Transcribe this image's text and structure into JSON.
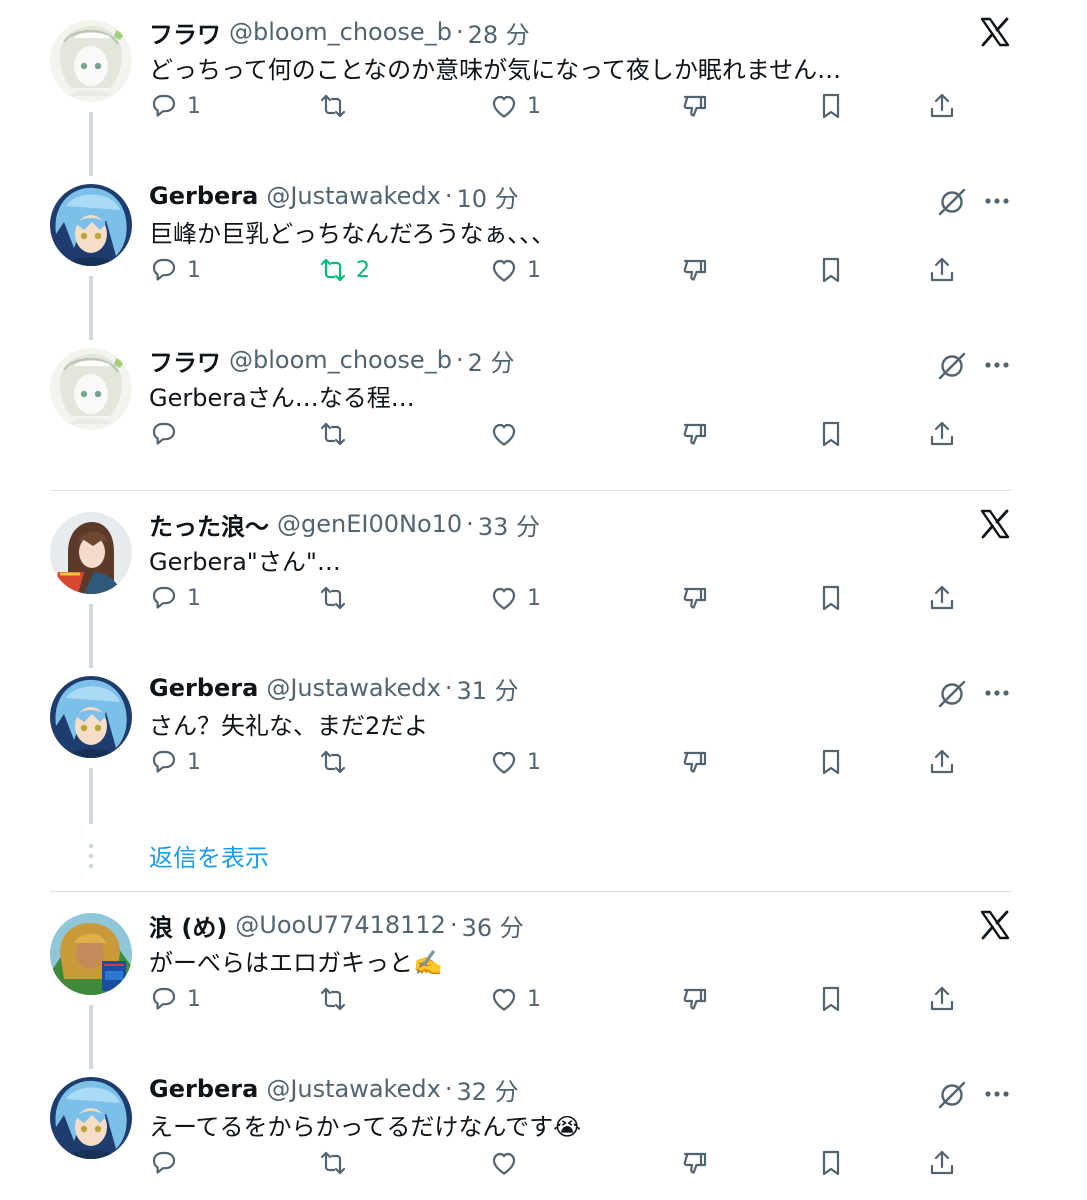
{
  "colors": {
    "text": "#0f1419",
    "muted": "#536471",
    "accent": "#1d9bf0",
    "retweet_active": "#00ba7c",
    "thread_line": "#cfd9de"
  },
  "icons": {
    "reply": "reply-icon",
    "retweet": "retweet-icon",
    "like": "heart-icon",
    "dislike": "thumbs-down-icon",
    "bookmark": "bookmark-icon",
    "share": "share-icon",
    "x_logo": "x-logo-icon",
    "grok": "grok-icon",
    "more": "more-icon"
  },
  "tweets": [
    {
      "name": "フラワ",
      "handle": "@bloom_choose_b",
      "dot": "·",
      "time": "28 分",
      "text": "どっちって何のことなのか意味が気になって夜しか眠れません…",
      "reply_count": "1",
      "retweet_count": "",
      "like_count": "1",
      "corner": "x-logo"
    },
    {
      "name": "Gerbera",
      "handle": "@Justawakedx",
      "dot": "·",
      "time": "10 分",
      "text": "巨峰か巨乳どっちなんだろうなぁ、、、",
      "reply_count": "1",
      "retweet_count": "2",
      "like_count": "1",
      "corner": "grok-more"
    },
    {
      "name": "フラワ",
      "handle": "@bloom_choose_b",
      "dot": "·",
      "time": "2 分",
      "text": "Gerberaさん…なる程…",
      "reply_count": "",
      "retweet_count": "",
      "like_count": "",
      "corner": "grok-more"
    },
    {
      "name": "たった浪〜",
      "handle": "@genEI00No10",
      "dot": "·",
      "time": "33 分",
      "text": "Gerbera\"さん\"…",
      "reply_count": "1",
      "retweet_count": "",
      "like_count": "1",
      "corner": "x-logo"
    },
    {
      "name": "Gerbera",
      "handle": "@Justawakedx",
      "dot": "·",
      "time": "31 分",
      "text": "さん？失礼な、まだ2だよ",
      "reply_count": "1",
      "retweet_count": "",
      "like_count": "1",
      "corner": "grok-more"
    },
    {
      "name": "浪 (め)",
      "handle": "@UooU77418112",
      "dot": "·",
      "time": "36 分",
      "text": "がーべらはエロガキっと✍️",
      "reply_count": "1",
      "retweet_count": "",
      "like_count": "1",
      "corner": "x-logo"
    },
    {
      "name": "Gerbera",
      "handle": "@Justawakedx",
      "dot": "·",
      "time": "32 分",
      "text": "えーてるをからかってるだけなんです😭",
      "reply_count": "",
      "retweet_count": "",
      "like_count": "",
      "corner": "grok-more"
    }
  ],
  "show_replies": "返信を表示"
}
